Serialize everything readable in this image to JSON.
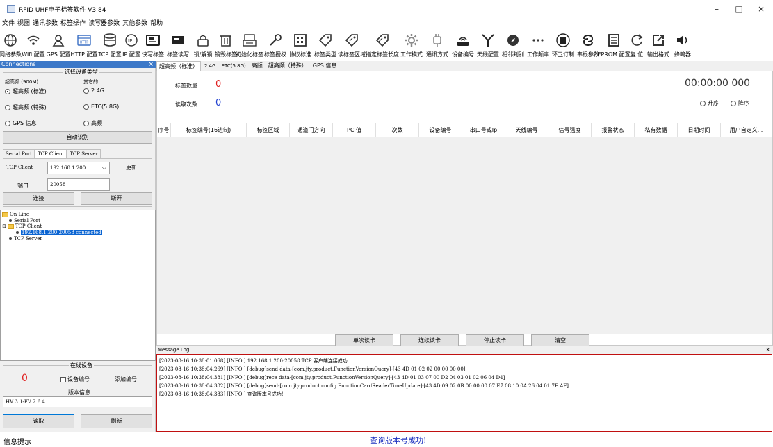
{
  "window": {
    "title": "RFID UHF电子标签软件 V3.84",
    "minimize": "–",
    "maximize": "□",
    "close": "×"
  },
  "menu": [
    "文件",
    "视图",
    "通讯参数",
    "标签操作",
    "读写器参数",
    "其他参数",
    "帮助"
  ],
  "toolbar": [
    {
      "label": "网络参数",
      "icon": "globe-icon"
    },
    {
      "label": "Wifi 配置",
      "icon": "wifi-icon"
    },
    {
      "label": "GPS 配置",
      "icon": "location-icon"
    },
    {
      "label": "HTTP 配置",
      "icon": "http-icon"
    },
    {
      "label": "TCP 配置",
      "icon": "database-icon"
    },
    {
      "label": "IP 配置",
      "icon": "ip-icon"
    },
    {
      "label": "快写标签",
      "icon": "card-write-icon"
    },
    {
      "label": "标签读写",
      "icon": "card-rw-icon"
    },
    {
      "label": "锁/解锁",
      "icon": "lock-icon"
    },
    {
      "label": "销毁标签",
      "icon": "trash-icon"
    },
    {
      "label": "初始化标签",
      "icon": "printer-icon"
    },
    {
      "label": "标签授权",
      "icon": "link-icon"
    },
    {
      "label": "协议标准",
      "icon": "grid-icon"
    },
    {
      "label": "标签类型",
      "icon": "tag-icon"
    },
    {
      "label": "读标签区域",
      "icon": "tag-read-icon"
    },
    {
      "label": "指定标签长度",
      "icon": "tag-length-icon"
    },
    {
      "label": "工作模式",
      "icon": "gear-icon"
    },
    {
      "label": "通讯方式",
      "icon": "plug-icon"
    },
    {
      "label": "设备编号",
      "icon": "router-icon"
    },
    {
      "label": "天线配置",
      "icon": "antenna-icon"
    },
    {
      "label": "相邻判别",
      "icon": "compass-icon"
    },
    {
      "label": "工作频率",
      "icon": "more-icon"
    },
    {
      "label": "环卫订制",
      "icon": "bin-icon"
    },
    {
      "label": "韦根参数",
      "icon": "chain-icon"
    },
    {
      "label": "EPROM 配置",
      "icon": "chip-icon"
    },
    {
      "label": "复 位",
      "icon": "reset-icon"
    },
    {
      "label": "输出格式",
      "icon": "export-icon"
    },
    {
      "label": "蜂鸣器",
      "icon": "speaker-icon"
    }
  ],
  "connections": {
    "header": "Connections",
    "close": "×",
    "device_type_title": "选择设备类型",
    "col1_title": "超高频 (900M)",
    "col2_title": "其它的",
    "radios": [
      {
        "label": "超高频 (标准)",
        "checked": true
      },
      {
        "label": "2.4G",
        "checked": false
      },
      {
        "label": "超高频 (特殊)",
        "checked": false
      },
      {
        "label": "ETC(5.8G)",
        "checked": false
      },
      {
        "label": "GPS 信息",
        "checked": false
      },
      {
        "label": "高频",
        "checked": false
      }
    ],
    "auto_detect": "自动识别",
    "tabs": [
      "Serial Port",
      "TCP Client",
      "TCP Server"
    ],
    "active_tab": 1,
    "tcp_client_label": "TCP Client",
    "tcp_client_value": "192.168.1.200",
    "refresh": "更新",
    "port_label": "端口",
    "port_value": "20058",
    "connect": "连接",
    "disconnect": "断开",
    "tree": {
      "root": "On Line",
      "serial": "Serial Port",
      "tcp_client": "TCP Client",
      "connected": "192.168.1.200:20058 connected",
      "tcp_server": "TCP Server"
    }
  },
  "device_panel": {
    "online_title": "在线设备",
    "online_count": "0",
    "device_no_label": "设备编号",
    "add_no": "添加编号",
    "version_title": "版本信息",
    "version_value": "HV 3.1-FV 2.6.4",
    "read": "读取",
    "refresh": "刷新"
  },
  "main": {
    "tabs": [
      "超高频（标准）",
      "2.4G",
      "ETC(5.8G)",
      "高频",
      "超高频（特殊）",
      "GPS 信息"
    ],
    "active_tab": 0,
    "tag_count_label": "标签数量",
    "tag_count": "0",
    "read_count_label": "读取次数",
    "read_count": "0",
    "timer": "00:00:00 000",
    "sort_asc": "升序",
    "sort_desc": "降序",
    "columns": [
      "序号",
      "标签编号(16进制)",
      "标签区域",
      "通道门方向",
      "PC 值",
      "次数",
      "设备编号",
      "串口号或Ip",
      "天线编号",
      "信号强度",
      "报警状态",
      "私有数据",
      "日期时间",
      "用户自定义..."
    ],
    "buttons": [
      "单次读卡",
      "连续读卡",
      "停止读卡",
      "清空"
    ]
  },
  "log": {
    "title": "Message Log",
    "close": "×",
    "lines": [
      "[2023-08-16 10:38:01.068] [INFO ] 192.168.1.200:20058 TCP 客户端连接成功",
      "[2023-08-16 10:38:04.269] [INFO ] [debug]send data-[com.jty.product.FunctionVersionQuery]-[43 4D 01 02 02 00 00 00 00]",
      "[2023-08-16 10:38:04.381] [INFO ] [debug]rece data-[com.jty.product.FunctionVersionQuery]-[43 4D 01 03 07 00 D2 04 03 01 02 06 04 D4]",
      "[2023-08-16 10:38:04.382] [INFO ] [debug]send-[com.jty.product.config.FunctionCardReaderTimeUpdate]-[43 4D 09 02 0B 00 00 00 07 E7 08 10 0A 26 04 01 7E AF]",
      "[2023-08-16 10:38:04.383] [INFO ] 查询版本号成功!"
    ]
  },
  "status": {
    "left": "信息提示",
    "center": "查询版本号成功!"
  }
}
